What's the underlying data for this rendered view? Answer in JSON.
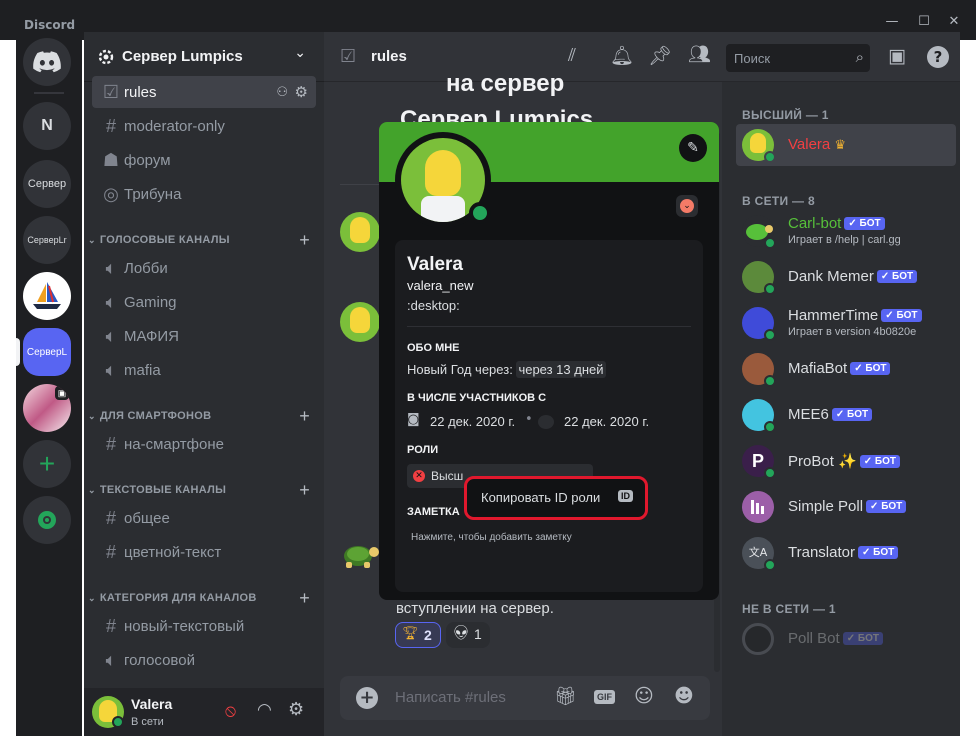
{
  "window": {
    "app_name": "Discord",
    "controls": [
      "—",
      "☐",
      "✕"
    ]
  },
  "servers": [
    {
      "label": "N"
    },
    {
      "label": "Сервер"
    },
    {
      "label": "СерверLr"
    },
    {
      "label": ""
    },
    {
      "label": "СерверL"
    },
    {
      "label": ""
    }
  ],
  "sidebar": {
    "server_name": "Сервер Lumpics",
    "channels": [
      {
        "label": "rules",
        "icon": "rules-icon"
      },
      {
        "label": "moderator-only",
        "icon": "hash-icon"
      },
      {
        "label": "форум",
        "icon": "forum-icon"
      },
      {
        "label": "Трибуна",
        "icon": "stage-icon"
      }
    ],
    "cat_voice": "ГОЛОСОВЫЕ КАНАЛЫ",
    "voice": [
      {
        "label": "Лобби"
      },
      {
        "label": "Gaming"
      },
      {
        "label": "МАФИЯ"
      },
      {
        "label": "mafia"
      }
    ],
    "cat_phones": "ДЛЯ СМАРТФОНОВ",
    "phones": [
      {
        "label": "на-смартфоне"
      }
    ],
    "cat_text": "ТЕКСТОВЫЕ КАНАЛЫ",
    "text": [
      {
        "label": "общее"
      },
      {
        "label": "цветной-текст"
      }
    ],
    "cat_channels": "КАТЕГОРИЯ ДЛЯ КАНАЛОВ",
    "cc": [
      {
        "label": "новый-текстовый"
      },
      {
        "label": "голосовой"
      }
    ]
  },
  "user": {
    "name": "Valera",
    "status": "В сети"
  },
  "header": {
    "channel": "rules",
    "search_placeholder": "Поиск"
  },
  "chat": {
    "heading_1": "на сервер",
    "heading_2": "Сервер Lumpics",
    "msg_tail": "вступлении на сервер.",
    "reaction_1": "2",
    "reaction_2": "1",
    "composer_placeholder": "Написать #rules"
  },
  "members": {
    "cat_top": "ВЫСШИЙ — 1",
    "top": [
      {
        "name": "Valera",
        "crown": "♛"
      }
    ],
    "cat_online": "В СЕТИ — 8",
    "online": [
      {
        "name": "Carl-bot",
        "sub": "Играет в /help | carl.gg",
        "color": "#57c03a"
      },
      {
        "name": "Dank Memer",
        "sub": "",
        "color": "#5c8a3b"
      },
      {
        "name": "HammerTime",
        "sub": "Играет в version 4b0820e",
        "color": "#3f4bd9"
      },
      {
        "name": "MafiaBot",
        "sub": "",
        "color": "#9a5a3c"
      },
      {
        "name": "MEE6",
        "sub": "",
        "color": "#43c4e0"
      },
      {
        "name": "ProBot",
        "sparkle": "✨",
        "sub": "",
        "color": "#3a1f4a"
      },
      {
        "name": "Simple Poll",
        "sub": "",
        "color": "#9c5fa8"
      },
      {
        "name": "Translator",
        "sub": "",
        "color": "#4a5058"
      }
    ],
    "bot_badge": "БОТ",
    "cat_offline": "НЕ В СЕТИ — 1",
    "offline": [
      {
        "name": "Poll Bot"
      }
    ]
  },
  "profile": {
    "display_name": "Valera",
    "username": "valera_new",
    "custom_status": ":desktop:",
    "about_title": "ОБО МНЕ",
    "about_text": "Новый Год через:",
    "about_highlight": "через 13 дней",
    "member_since_title": "В ЧИСЛЕ УЧАСТНИКОВ С",
    "discord_date": "22 дек. 2020 г.",
    "server_date": "22 дек. 2020 г.",
    "roles_title": "РОЛИ",
    "role_name": "Высш",
    "note_title": "ЗАМЕТКА",
    "note_placeholder": "Нажмите, чтобы добавить заметку"
  },
  "context_menu": {
    "copy_role_id": "Копировать ID роли",
    "id_badge": "ID"
  },
  "colors": {
    "accent": "#5865f2",
    "online": "#23a55a",
    "banner": "#43a32b",
    "highlight_ring": "#e0182d",
    "role_top": "#f23f42"
  }
}
